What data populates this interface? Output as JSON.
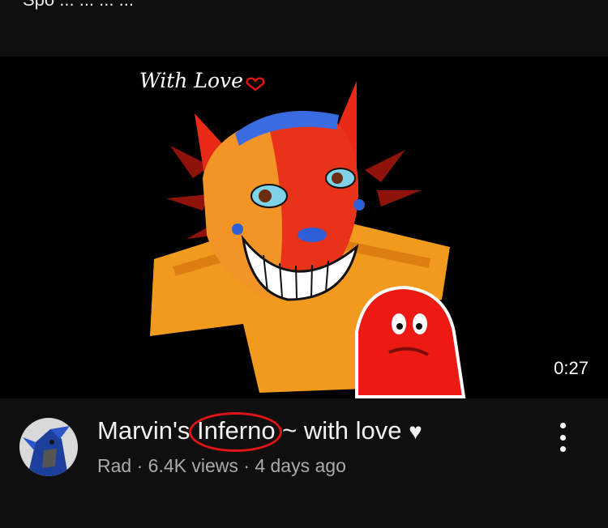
{
  "header": {
    "cut_off_text": "Spo   ... ... ... ..."
  },
  "video": {
    "thumbnail_caption": "With Love",
    "thumbnail_icon": "heart-outline-icon",
    "duration": "0:27",
    "title_before": "Marvin's ",
    "title_highlight": "Inferno",
    "title_after": " ~ with love ",
    "title_emoji": "♥",
    "channel": "Rad",
    "separator": "·",
    "views": "6.4K views",
    "age": "4 days ago",
    "more_icon": "kebab-menu-icon",
    "highlight_color": "#e01414"
  }
}
